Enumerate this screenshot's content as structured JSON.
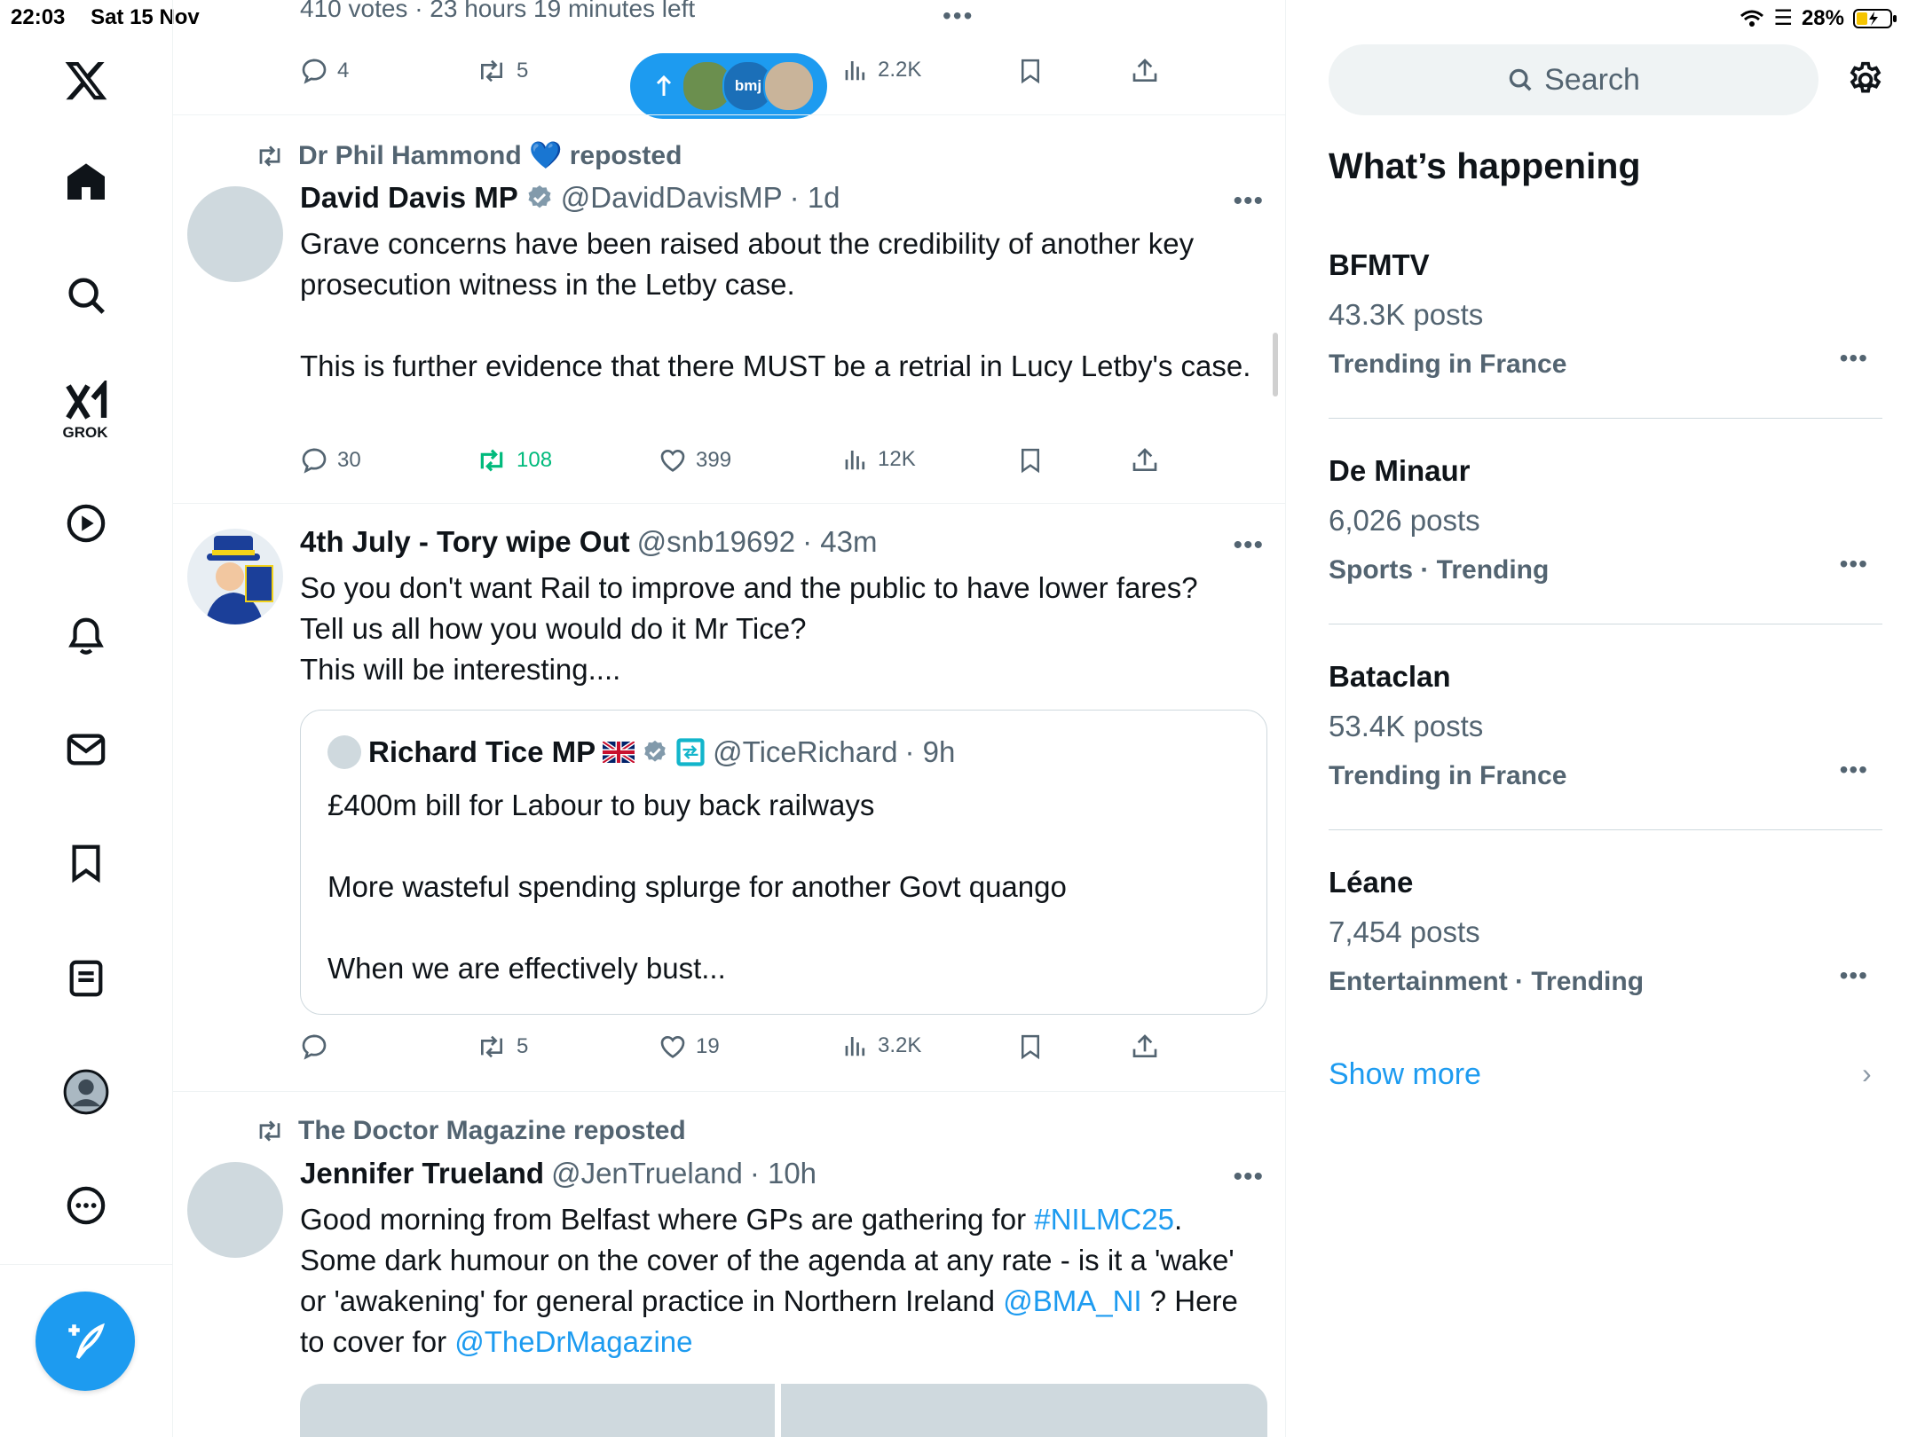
{
  "status_bar": {
    "time": "22:03",
    "date": "Sat 15 Nov",
    "battery": "28%"
  },
  "nav": {
    "grok_label": "GROK"
  },
  "feed": {
    "top_poll": {
      "votes_text": "410 votes · 23 hours 19 minutes left",
      "replies": "4",
      "reposts": "5",
      "views": "2.2K"
    },
    "new_posts_pill": {
      "bmj_label": "bmj"
    },
    "tweet1": {
      "repost_by": "Dr Phil Hammond 💙 reposted",
      "name": "David Davis MP",
      "handle": "@DavidDavisMP",
      "time": "· 1d",
      "text": "Grave concerns have been raised about the credibility of another key prosecution witness in the Letby case.\n\nThis is further evidence that there MUST be a retrial in Lucy Letby's case.",
      "replies": "30",
      "reposts": "108",
      "likes": "399",
      "views": "12K"
    },
    "tweet2": {
      "name": "4th July - Tory wipe Out",
      "handle": "@snb19692",
      "time": "· 43m",
      "text": "So you don't want Rail to improve and the public to have lower fares?\nTell us all how you would do it Mr Tice?\nThis will be interesting....",
      "quote": {
        "name": "Richard Tice MP",
        "flag": "🇬🇧",
        "handle": "@TiceRichard",
        "time": "· 9h",
        "text": "£400m bill for Labour to buy back railways\n\nMore wasteful spending splurge for another Govt quango\n\nWhen we are effectively bust..."
      },
      "replies": "",
      "reposts": "5",
      "likes": "19",
      "views": "3.2K"
    },
    "tweet3": {
      "repost_by": "The Doctor Magazine reposted",
      "name": "Jennifer Trueland",
      "handle": "@JenTrueland",
      "time": "· 10h",
      "text_part1": "Good morning from Belfast where GPs are gathering for ",
      "hashtag": "#NILMC25",
      "text_part2": ".\nSome dark humour on the cover of the agenda at any rate - is it a 'wake' or 'awakening' for general practice in Northern Ireland ",
      "mention1": "@BMA_NI",
      "text_part3": " ? Here to cover for ",
      "mention2": "@TheDrMagazine"
    }
  },
  "right": {
    "search_placeholder": "Search",
    "whats_happening": "What’s happening",
    "trends": [
      {
        "name": "BFMTV",
        "posts": "43.3K posts",
        "context": "Trending in France"
      },
      {
        "name": "De Minaur",
        "posts": "6,026 posts",
        "context": "Sports · Trending"
      },
      {
        "name": "Bataclan",
        "posts": "53.4K posts",
        "context": "Trending in France"
      },
      {
        "name": "Léane",
        "posts": "7,454 posts",
        "context": "Entertainment · Trending"
      }
    ],
    "show_more": "Show more"
  },
  "colors": {
    "accent": "#1d9bf0",
    "repost_green": "#00ba7c",
    "muted": "#536471"
  },
  "icons": [
    "x-logo-icon",
    "home-icon",
    "search-icon",
    "grok-icon",
    "video-icon",
    "bell-icon",
    "mail-icon",
    "bookmark-icon",
    "lists-icon",
    "profile-icon",
    "more-icon",
    "compose-icon",
    "reply-icon",
    "repost-icon",
    "like-icon",
    "views-icon",
    "share-icon",
    "verified-icon",
    "gear-icon",
    "chevron-right-icon"
  ]
}
